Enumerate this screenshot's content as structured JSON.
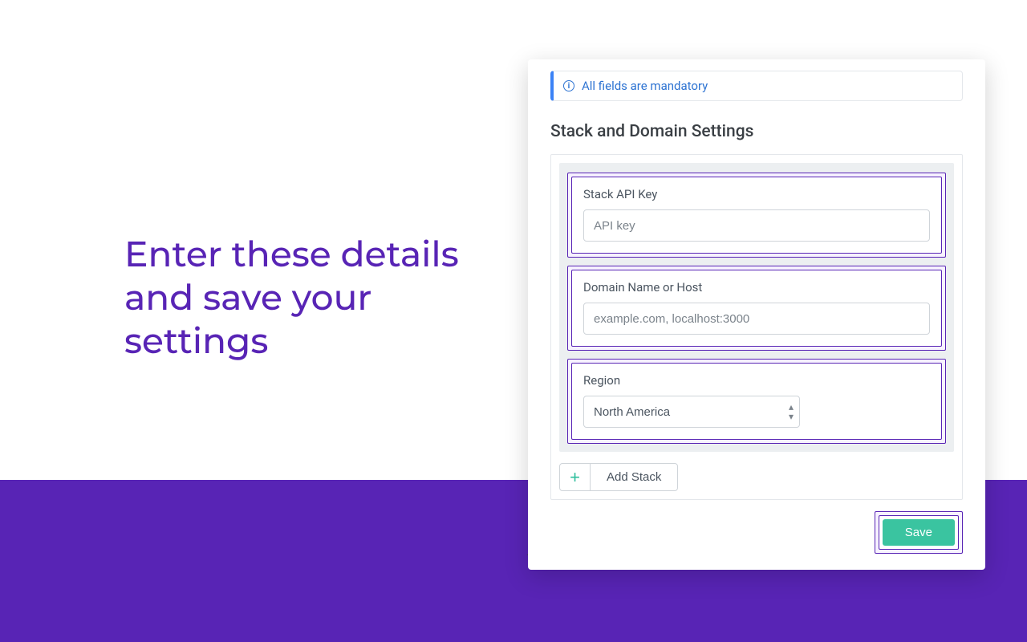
{
  "headline": "Enter these details and save your settings",
  "alert": {
    "text": "All fields are mandatory"
  },
  "section_title": "Stack and Domain Settings",
  "fields": {
    "api_key": {
      "label": "Stack API Key",
      "placeholder": "API key",
      "value": ""
    },
    "domain": {
      "label": "Domain Name or Host",
      "placeholder": "example.com, localhost:3000",
      "value": ""
    },
    "region": {
      "label": "Region",
      "selected": "North America"
    }
  },
  "add_stack_label": "Add Stack",
  "save_label": "Save"
}
